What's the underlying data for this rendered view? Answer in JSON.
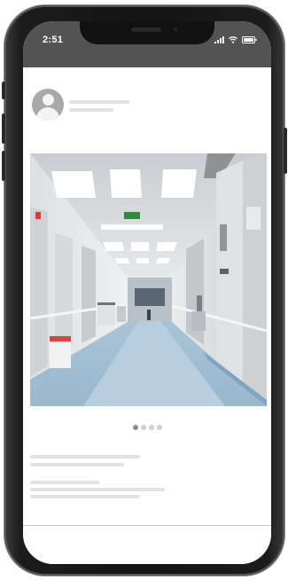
{
  "status_bar": {
    "time": "2:51",
    "icons": [
      "signal-icon",
      "wifi-icon",
      "battery-icon"
    ]
  },
  "post": {
    "avatar_icon": "user-avatar-icon",
    "image": "hospital-corridor-photo",
    "carousel": {
      "total": 4,
      "active_index": 0
    }
  },
  "colors": {
    "status_bar_bg": "#535353",
    "placeholder_line": "#e2e2e2",
    "dot_active": "#8c8c8c",
    "dot_inactive": "#cfcfcf"
  }
}
